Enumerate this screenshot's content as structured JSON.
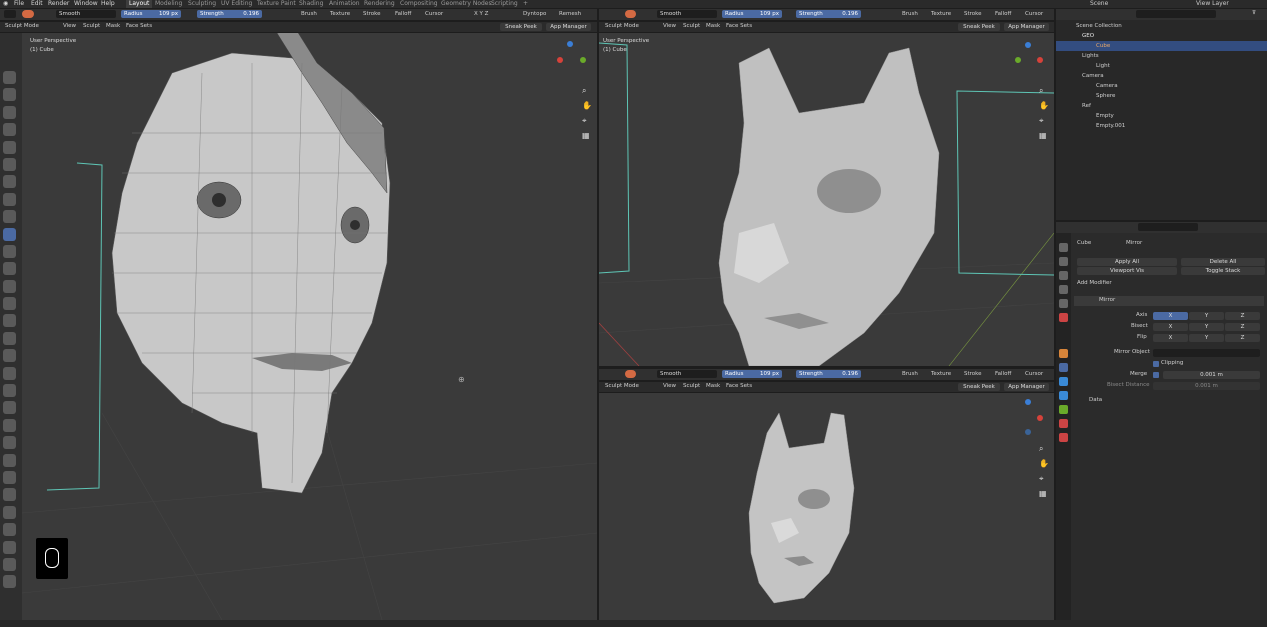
{
  "menubar": {
    "items": [
      "File",
      "Edit",
      "Render",
      "Window",
      "Help"
    ],
    "workspaces": [
      "Layout",
      "Modeling",
      "Sculpting",
      "UV Editing",
      "Texture Paint",
      "Shading",
      "Animation",
      "Rendering",
      "Compositing",
      "Geometry Nodes",
      "Scripting"
    ],
    "active_workspace": "Layout",
    "scene": "Scene",
    "view_layer": "View Layer",
    "add_tab": "+"
  },
  "tool_header": {
    "brush_name": "Smooth",
    "radius_label": "Radius",
    "radius_value": "109 px",
    "strength_label": "Strength",
    "strength_value": "0.196",
    "menus": [
      "Brush",
      "Texture",
      "Stroke",
      "Falloff",
      "Cursor"
    ],
    "xyz": "X Y Z",
    "dyntopo": "Dyntopo",
    "remesh": "Remesh"
  },
  "view_header": {
    "mode": "Sculpt Mode",
    "menus": [
      "View",
      "Sculpt",
      "Mask",
      "Face Sets"
    ],
    "sneak_peek": "Sneak Peek",
    "app_manager": "App Manager"
  },
  "viewport_overlay": {
    "perspective": "User Perspective",
    "object": "(1) Cube"
  },
  "outliner": {
    "title": "Scene Collection",
    "rows": [
      {
        "name": "GEO",
        "type": "collection"
      },
      {
        "name": "Cube",
        "type": "mesh"
      },
      {
        "name": "Lights",
        "type": "collection"
      },
      {
        "name": "Light",
        "type": "light"
      },
      {
        "name": "Camera",
        "type": "collection"
      },
      {
        "name": "Camera",
        "type": "camera"
      },
      {
        "name": "Sphere",
        "type": "mesh"
      },
      {
        "name": "Ref",
        "type": "collection"
      },
      {
        "name": "Empty",
        "type": "empty"
      },
      {
        "name": "Empty.001",
        "type": "empty"
      }
    ]
  },
  "properties": {
    "object_name": "Cube",
    "modifier_tab": "Mirror",
    "apply_all": "Apply All",
    "delete_all": "Delete All",
    "viewport_vis": "Viewport Vis",
    "toggle_stack": "Toggle Stack",
    "add_modifier": "Add Modifier",
    "modifier_name": "Mirror",
    "axis_label": "Axis",
    "bisect_label": "Bisect",
    "flip_label": "Flip",
    "axes": [
      "X",
      "Y",
      "Z"
    ],
    "mirror_object_label": "Mirror Object",
    "clipping_label": "Clipping",
    "merge_label": "Merge",
    "merge_value": "0.001 m",
    "bisect_distance_label": "Bisect Distance",
    "bisect_distance_value": "0.001 m",
    "data_label": "Data"
  },
  "colors": {
    "accent": "#4b6aa3",
    "viewport_bg": "#3a3a3a",
    "header_bg": "#303030"
  }
}
